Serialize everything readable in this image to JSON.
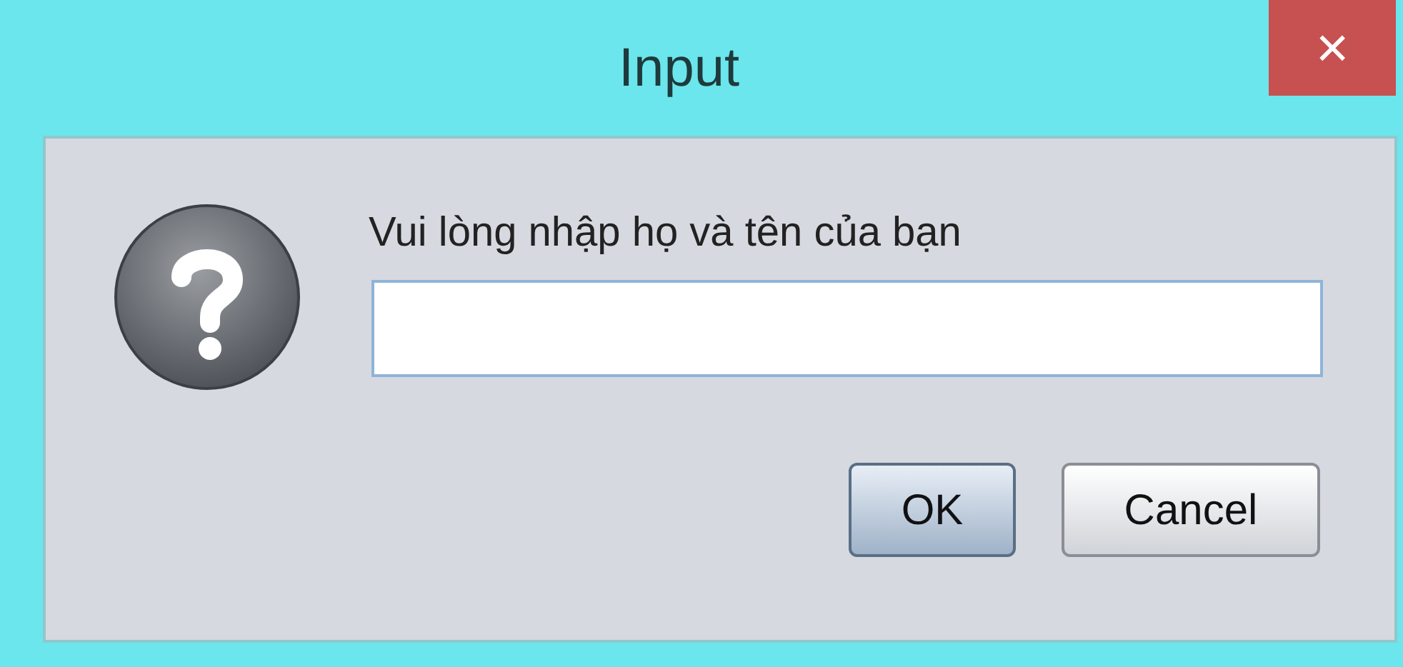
{
  "window": {
    "title": "Input",
    "close": "×"
  },
  "message": "Vui lòng nhập họ và tên của bạn",
  "buttons": [
    {
      "label": "OK",
      "kind": "default"
    },
    {
      "label": "Cancel",
      "kind": "normal"
    }
  ]
}
